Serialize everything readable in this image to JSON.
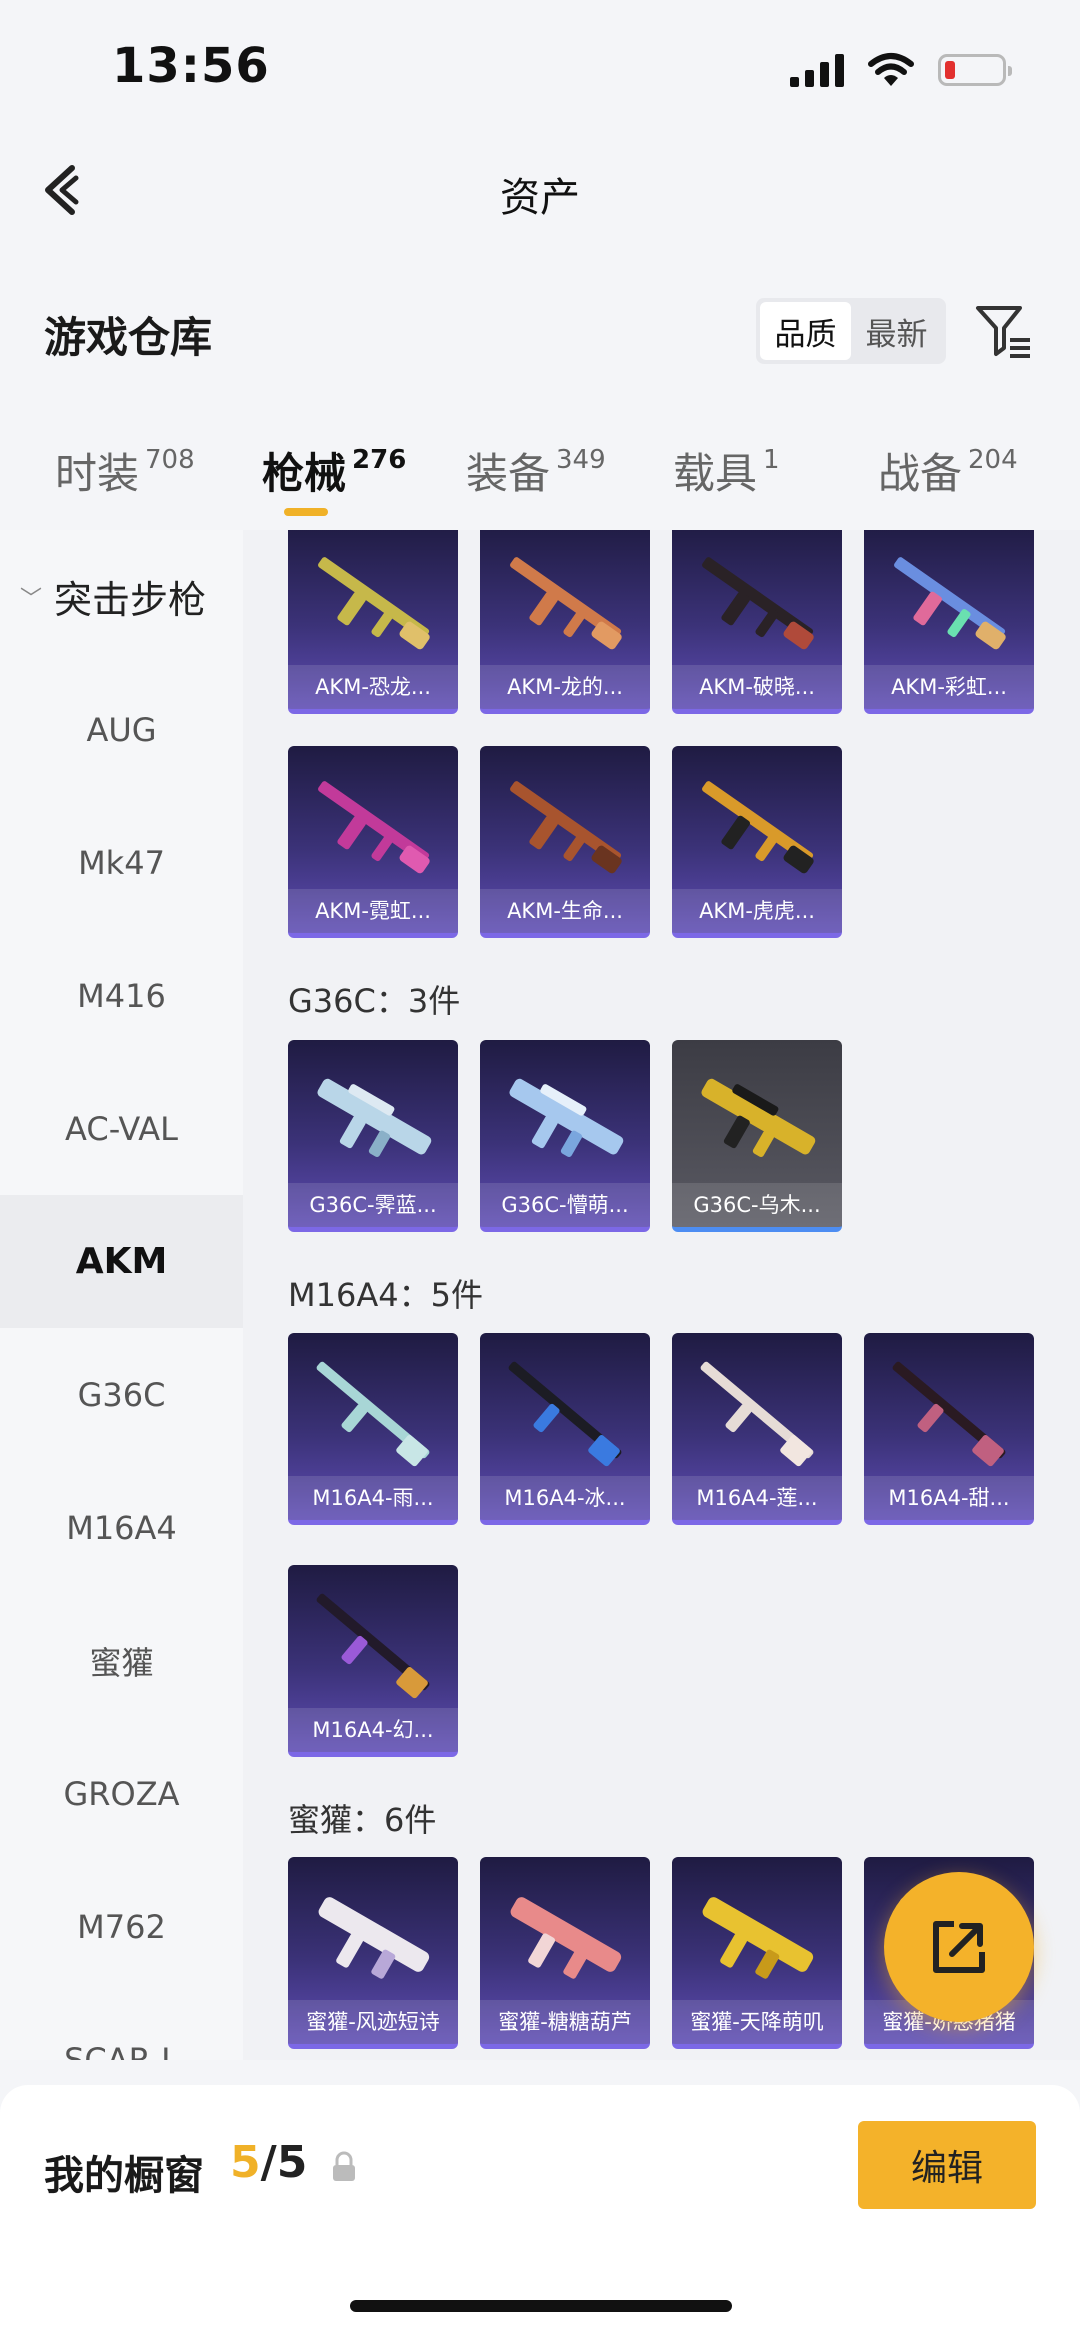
{
  "status": {
    "time": "13:56"
  },
  "nav": {
    "title": "资产"
  },
  "header": {
    "title": "游戏仓库",
    "sort_options": [
      "品质",
      "最新"
    ]
  },
  "tabs": [
    {
      "label": "时装",
      "count": "708"
    },
    {
      "label": "枪械",
      "count": "276"
    },
    {
      "label": "装备",
      "count": "349"
    },
    {
      "label": "载具",
      "count": "1"
    },
    {
      "label": "战备",
      "count": "204"
    }
  ],
  "sidebar": {
    "category": "突击步枪",
    "items": [
      "AUG",
      "Mk47",
      "M416",
      "AC-VAL",
      "AKM",
      "G36C",
      "M16A4",
      "蜜獾",
      "GROZA",
      "M762",
      "SCAR-L"
    ]
  },
  "groups": {
    "akm": {
      "items": [
        "AKM-恐龙...",
        "AKM-龙的...",
        "AKM-破晓...",
        "AKM-彩虹...",
        "AKM-霓虹...",
        "AKM-生命...",
        "AKM-虎虎..."
      ]
    },
    "g36c": {
      "label": "G36C：3件",
      "items": [
        "G36C-霁蓝...",
        "G36C-懵萌...",
        "G36C-乌木..."
      ]
    },
    "m16a4": {
      "label": "M16A4：5件",
      "items": [
        "M16A4-雨...",
        "M16A4-冰...",
        "M16A4-莲...",
        "M16A4-甜...",
        "M16A4-幻..."
      ]
    },
    "honeybadger": {
      "label": "蜜獾：6件",
      "items": [
        "蜜獾-风迹短诗",
        "蜜獾-糖糖葫芦",
        "蜜獾-天降萌叽",
        "蜜獾-娇憨猪猪"
      ]
    }
  },
  "bottom": {
    "label": "我的橱窗",
    "current": "5",
    "separator": "/5",
    "edit_label": "编辑"
  },
  "colors": {
    "accent": "#f4b22a",
    "tile_top": "#1f1b42",
    "tile_bottom": "#5e4cb3"
  }
}
